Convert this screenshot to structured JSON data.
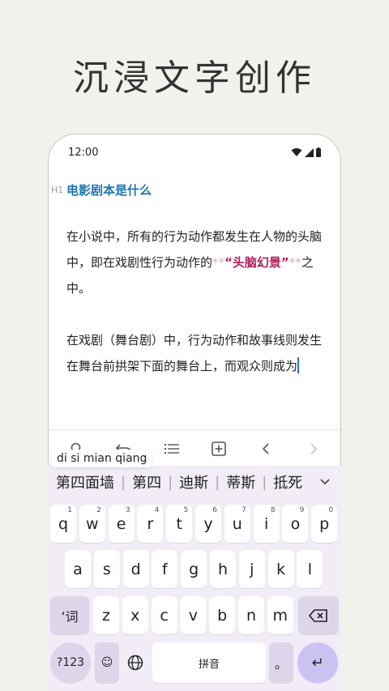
{
  "headline": "沉浸文字创作",
  "status": {
    "time": "12:00"
  },
  "editor": {
    "heading_marker": "H1",
    "title": "电影剧本是什么",
    "para1_a": "在小说中，所有的行为动作都发生在人物的头脑中，即在戏剧性行为动作的",
    "md_open": "**",
    "para1_highlight": "“头脑幻景”",
    "md_close": "**",
    "para1_b": "之中。",
    "para2": "在戏剧（舞台剧）中，行为动作和故事线则发生在舞台前拱架下面的舞台上，而观众则成为"
  },
  "toolbar": {
    "items": [
      "search-icon",
      "undo-icon",
      "list-icon",
      "add-box-icon",
      "chevron-left-icon",
      "chevron-right-icon"
    ]
  },
  "ime": {
    "pinyin": "di si mian qiang",
    "candidates": [
      "第四面墙",
      "第四",
      "迪斯",
      "蒂斯",
      "抵死"
    ],
    "row1": [
      {
        "label": "q",
        "sup": "1"
      },
      {
        "label": "w",
        "sup": "2"
      },
      {
        "label": "e",
        "sup": "3"
      },
      {
        "label": "r",
        "sup": "4"
      },
      {
        "label": "t",
        "sup": "5"
      },
      {
        "label": "y",
        "sup": "6"
      },
      {
        "label": "u",
        "sup": "7"
      },
      {
        "label": "i",
        "sup": "8"
      },
      {
        "label": "o",
        "sup": "9"
      },
      {
        "label": "p",
        "sup": "0"
      }
    ],
    "row2": [
      "a",
      "s",
      "d",
      "f",
      "g",
      "h",
      "j",
      "k",
      "l"
    ],
    "row3": [
      "z",
      "x",
      "c",
      "v",
      "b",
      "n",
      "m"
    ],
    "shift_label": "ʻ词",
    "symbols_label": "?123",
    "emoji_label": "☺",
    "comma_label": ",",
    "space_label": "拼音",
    "period_label": "。",
    "enter_label": "↵"
  }
}
